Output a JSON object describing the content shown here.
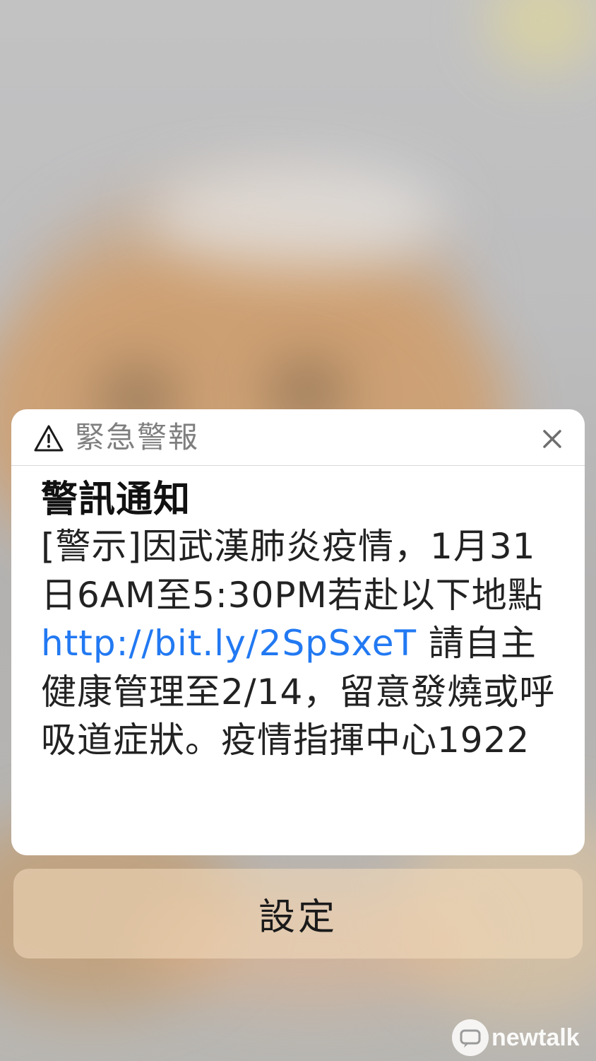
{
  "alert": {
    "header_title": "緊急警報",
    "warning_icon": "warning-triangle-icon",
    "close_icon": "close-icon",
    "heading": "警訊通知",
    "message_before_link": "[警示]因武漢肺炎疫情，1月31日6AM至5:30PM若赴以下地點",
    "link_text": "http://bit.ly/2SpSxeT",
    "message_after_link": " 請自主健康管理至2/14，留意發燒或呼吸道症狀。疫情指揮中心1922"
  },
  "settings_button": {
    "label": "設定"
  },
  "watermark": {
    "text": "newtalk"
  },
  "colors": {
    "link": "#2279f2",
    "header_text": "#7f7f7f",
    "card": "#ffffff"
  }
}
